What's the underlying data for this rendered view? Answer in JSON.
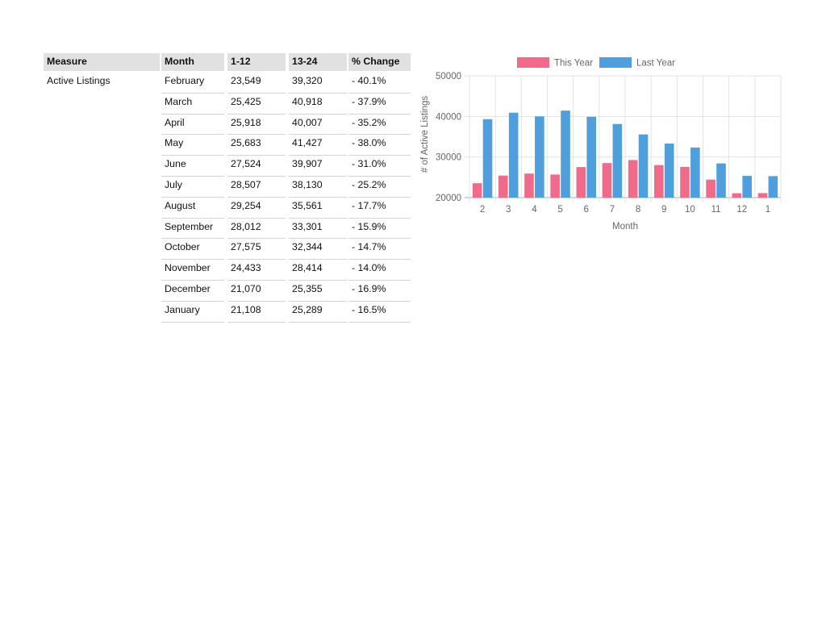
{
  "table": {
    "headers": [
      "Measure",
      "Month",
      "1-12",
      "13-24",
      "% Change"
    ],
    "measure_label": "Active Listings",
    "rows": [
      {
        "month": "February",
        "a": "23,549",
        "b": "39,320",
        "pct": "- 40.1%"
      },
      {
        "month": "March",
        "a": "25,425",
        "b": "40,918",
        "pct": "- 37.9%"
      },
      {
        "month": "April",
        "a": "25,918",
        "b": "40,007",
        "pct": "- 35.2%"
      },
      {
        "month": "May",
        "a": "25,683",
        "b": "41,427",
        "pct": "- 38.0%"
      },
      {
        "month": "June",
        "a": "27,524",
        "b": "39,907",
        "pct": "- 31.0%"
      },
      {
        "month": "July",
        "a": "28,507",
        "b": "38,130",
        "pct": "- 25.2%"
      },
      {
        "month": "August",
        "a": "29,254",
        "b": "35,561",
        "pct": "- 17.7%"
      },
      {
        "month": "September",
        "a": "28,012",
        "b": "33,301",
        "pct": "- 15.9%"
      },
      {
        "month": "October",
        "a": "27,575",
        "b": "32,344",
        "pct": "- 14.7%"
      },
      {
        "month": "November",
        "a": "24,433",
        "b": "28,414",
        "pct": "- 14.0%"
      },
      {
        "month": "December",
        "a": "21,070",
        "b": "25,355",
        "pct": "- 16.9%"
      },
      {
        "month": "January",
        "a": "21,108",
        "b": "25,289",
        "pct": "- 16.5%"
      }
    ]
  },
  "chart_data": {
    "type": "bar",
    "categories": [
      "2",
      "3",
      "4",
      "5",
      "6",
      "7",
      "8",
      "9",
      "10",
      "11",
      "12",
      "1"
    ],
    "series": [
      {
        "name": "This Year",
        "color": "#f06a8a",
        "values": [
          23549,
          25425,
          25918,
          25683,
          27524,
          28507,
          29254,
          28012,
          27575,
          24433,
          21070,
          21108
        ]
      },
      {
        "name": "Last Year",
        "color": "#4f9fdc",
        "values": [
          39320,
          40918,
          40007,
          41427,
          39907,
          38130,
          35561,
          33301,
          32344,
          28414,
          25355,
          25289
        ]
      }
    ],
    "title": "",
    "xlabel": "Month",
    "ylabel": "# of Active Listings",
    "ylim": [
      20000,
      50000
    ],
    "yticks": [
      "20000",
      "30000",
      "40000",
      "50000"
    ],
    "legend_position": "top-center",
    "grid": true
  }
}
